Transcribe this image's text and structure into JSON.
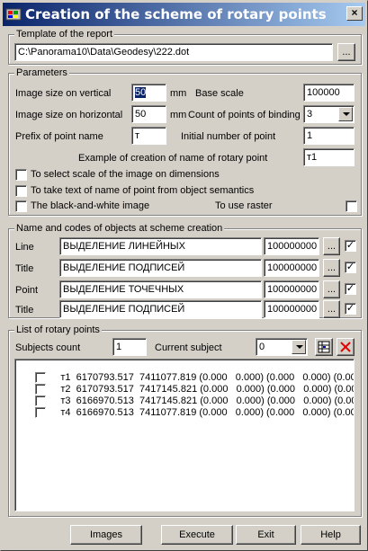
{
  "window": {
    "title": "Creation of the scheme of rotary points",
    "close_label": "×"
  },
  "template_group": {
    "legend": "Template of the report",
    "path": "C:\\Panorama10\\Data\\Geodesy\\222.dot",
    "browse_label": "..."
  },
  "parameters": {
    "legend": "Parameters",
    "image_vertical_label": "Image size on vertical",
    "image_vertical_value": "50",
    "image_vertical_unit": "mm",
    "base_scale_label": "Base scale",
    "base_scale_value": "100000",
    "image_horizontal_label": "Image size on horizontal",
    "image_horizontal_value": "50",
    "image_horizontal_unit": "mm",
    "count_binding_label": "Count of points of binding",
    "count_binding_value": "3",
    "prefix_label": "Prefix of point name",
    "prefix_value": "т",
    "initial_number_label": "Initial number of point",
    "initial_number_value": "1",
    "example_label": "Example of creation of name of rotary point",
    "example_value": "т1",
    "check_scale_label": "To select scale of the image on dimensions",
    "check_semantics_label": "To take text of name of point from object semantics",
    "check_bw_label": "The black-and-white image",
    "check_raster_label": "To use raster"
  },
  "codes_group": {
    "legend": "Name and codes of objects at scheme creation",
    "rows": [
      {
        "label": "Line",
        "name": "ВЫДЕЛЕНИЕ ЛИНЕЙНЫХ",
        "code": "100000000",
        "browse": "...",
        "check": "✓"
      },
      {
        "label": "Title",
        "name": "ВЫДЕЛЕНИЕ ПОДПИСЕЙ",
        "code": "100000000",
        "browse": "...",
        "check": "✓"
      },
      {
        "label": "Point",
        "name": "ВЫДЕЛЕНИЕ ТОЧЕЧНЫХ",
        "code": "100000000",
        "browse": "...",
        "check": "✓"
      },
      {
        "label": "Title",
        "name": "ВЫДЕЛЕНИЕ ПОДПИСЕЙ",
        "code": "100000000",
        "browse": "...",
        "check": "✓"
      }
    ]
  },
  "points_group": {
    "legend": "List of rotary points",
    "subjects_count_label": "Subjects count",
    "subjects_count_value": "1",
    "current_subject_label": "Current subject",
    "current_subject_value": "0",
    "rows": [
      "т1  6170793.517  7411077.819 (0.000   0.000) (0.000   0.000) (0.000   0.00",
      "т2  6170793.517  7417145.821 (0.000   0.000) (0.000   0.000) (0.000   0.00",
      "т3  6166970.513  7417145.821 (0.000   0.000) (0.000   0.000) (0.000   0.00",
      "т4  6166970.513  7411077.819 (0.000   0.000) (0.000   0.000) (0.000   0.00"
    ]
  },
  "buttons": {
    "images": "Images",
    "execute": "Execute",
    "exit": "Exit",
    "help": "Help"
  },
  "icons": {
    "app": "app-icon",
    "table": "table-icon",
    "delete": "delete-x-icon"
  }
}
